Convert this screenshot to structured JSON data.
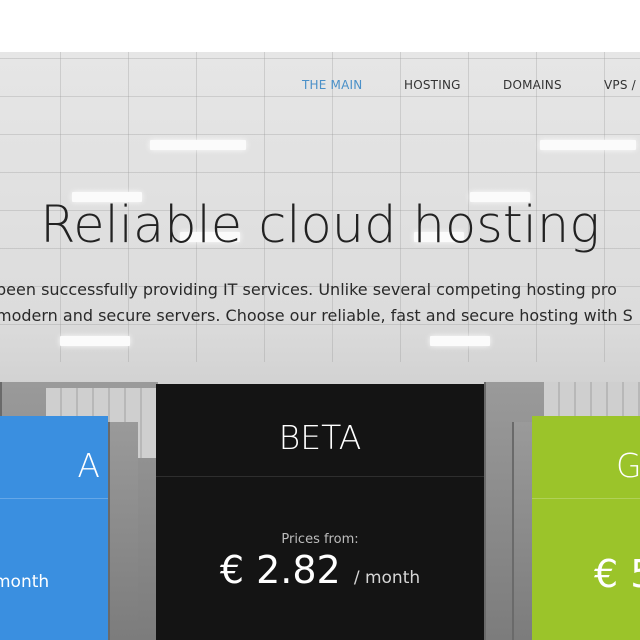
{
  "nav": {
    "items": [
      {
        "label": "THE MAIN",
        "active": true
      },
      {
        "label": "HOSTING",
        "active": false
      },
      {
        "label": "DOMAINS",
        "active": false
      },
      {
        "label": "VPS /",
        "active": false
      }
    ]
  },
  "hero": {
    "headline": "Reliable cloud hosting",
    "subline_1": " been successfully providing IT services. Unlike several competing hosting pro",
    "subline_2": "modern and secure servers. Choose our reliable, fast and secure hosting with S"
  },
  "plans": [
    {
      "name": "A",
      "price": "",
      "unit": "month",
      "color": "#3a8fe0"
    },
    {
      "name": "BETA",
      "prices_from_label": "Prices from:",
      "price": "€ 2.82",
      "unit": "/ month",
      "color": "#141414"
    },
    {
      "name": "G",
      "price": "€ 5",
      "unit": "",
      "color": "#9bc42a"
    }
  ],
  "colors": {
    "accent": "#4a90c8",
    "nav_text": "#333333"
  }
}
